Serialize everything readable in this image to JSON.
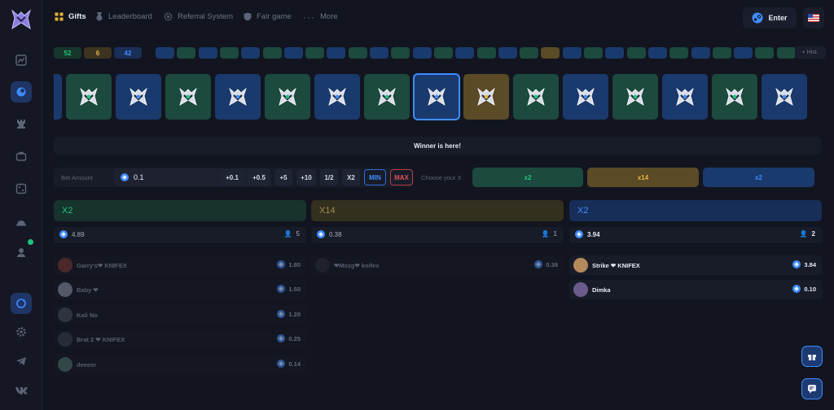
{
  "nav": {
    "gifts": "Gifts",
    "leaderboard": "Leaderboard",
    "referral": "Referral System",
    "fair_game": "Fair game",
    "more": "More",
    "enter": "Enter"
  },
  "sidebar_icons": [
    "chart-icon",
    "coin-icon",
    "rook-icon",
    "briefcase-icon",
    "dice-icon",
    "helmet-icon",
    "user-online-icon",
    "refresh-icon",
    "settings-icon",
    "telegram-icon",
    "vk-icon"
  ],
  "history": {
    "counts": [
      {
        "value": "52",
        "color": "#21c37a",
        "bg": "#17372c"
      },
      {
        "value": "6",
        "color": "#e4b33a",
        "bg": "#3d3420"
      },
      {
        "value": "42",
        "color": "#3f8cff",
        "bg": "#1a2f57"
      }
    ],
    "squares": [
      "blue",
      "green",
      "blue",
      "green",
      "blue",
      "green",
      "blue",
      "green",
      "blue",
      "green",
      "blue",
      "green",
      "blue",
      "green",
      "blue",
      "green",
      "blue",
      "green",
      "gold",
      "blue",
      "green",
      "blue",
      "green",
      "blue",
      "green",
      "blue",
      "green",
      "blue",
      "green",
      "green"
    ],
    "hist_label": "Hist."
  },
  "strip": [
    "blue",
    "green",
    "blue",
    "green",
    "blue",
    "green",
    "blue",
    "green",
    "blue-selected",
    "gold",
    "green",
    "blue",
    "green",
    "blue",
    "green",
    "blue"
  ],
  "winner_text": "Winner is here!",
  "bet": {
    "label": "Bet Amount",
    "value": "0.1",
    "quick": [
      "+0.1",
      "+0.5",
      "+5",
      "+10",
      "1/2",
      "X2",
      "MIN",
      "MAX"
    ],
    "choose_label": "Choose your X",
    "choices": [
      "x2",
      "x14",
      "x2"
    ]
  },
  "columns": [
    {
      "title": "X2",
      "total": "4.89",
      "players": "5",
      "rows": [
        {
          "name": "Garry's❤ KNIFEX",
          "amount": "1.80",
          "avatar": "#7a3b32"
        },
        {
          "name": "Baby ❤",
          "amount": "1.50",
          "avatar": "#8a8fa6"
        },
        {
          "name": "Kali No",
          "amount": "1.20",
          "avatar": "#4a4f5e"
        },
        {
          "name": "Brat 2 ❤ KNIFEX",
          "amount": "0.25",
          "avatar": "#3a3f4d"
        },
        {
          "name": "deeeer",
          "amount": "0.14",
          "avatar": "#4f6f6a"
        }
      ]
    },
    {
      "title": "X14",
      "total": "0.38",
      "players": "1",
      "rows": [
        {
          "name": "❤Mozg❤ knifex",
          "amount": "0.38",
          "avatar": "#2a2e38"
        }
      ]
    },
    {
      "title": "X2",
      "total": "3.94",
      "players": "2",
      "rows": [
        {
          "name": "Strike ❤ KNIFEX",
          "amount": "3.84",
          "avatar": "#b58a5a"
        },
        {
          "name": "Dimka",
          "amount": "0.10",
          "avatar": "#6b5a8c"
        }
      ]
    }
  ],
  "colors": {
    "green": "#1c4a3e",
    "blue": "#1a3a6e",
    "gold": "#5a4a26",
    "green_text": "#21c37a",
    "gold_text": "#e4b33a",
    "blue_text": "#3f8cff"
  }
}
